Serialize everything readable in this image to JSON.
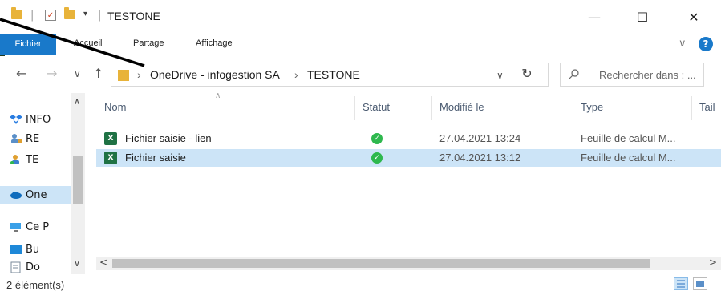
{
  "window": {
    "title": "TESTONE",
    "minimize": "—",
    "maximize": "☐",
    "close": "✕"
  },
  "ribbon": {
    "tabs": [
      "Fichier",
      "Accueil",
      "Partage",
      "Affichage"
    ],
    "collapse": "∨",
    "help": "?"
  },
  "address": {
    "back": "←",
    "forward": "→",
    "recent": "∨",
    "up": "↑",
    "sep": "›",
    "crumbs": [
      "OneDrive - infogestion SA",
      "TESTONE"
    ],
    "dropdown": "∨",
    "refresh": "↻",
    "search_placeholder": "Rechercher dans : ..."
  },
  "sidebar": {
    "items": [
      {
        "label": "INFO",
        "icon": "dropbox-icon"
      },
      {
        "label": "RE",
        "icon": "network-user-icon"
      },
      {
        "label": "TE",
        "icon": "user-icon"
      },
      {
        "label": "One",
        "icon": "onedrive-cloud-icon"
      },
      {
        "label": "Ce P",
        "icon": "pc-icon"
      },
      {
        "label": "Bu",
        "icon": "desktop-icon"
      },
      {
        "label": "Do",
        "icon": "documents-icon"
      }
    ]
  },
  "columns": {
    "name": "Nom",
    "status": "Statut",
    "modified": "Modifié le",
    "type": "Type",
    "size": "Tail"
  },
  "files": [
    {
      "name": "Fichier saisie - lien",
      "status": "synced",
      "modified": "27.04.2021 13:24",
      "type": "Feuille de calcul M..."
    },
    {
      "name": "Fichier saisie",
      "status": "synced",
      "modified": "27.04.2021 13:12",
      "type": "Feuille de calcul M..."
    }
  ],
  "status_bar": {
    "count": "2 élément(s)"
  },
  "colors": {
    "accent": "#1979ca",
    "selection": "#cce4f7",
    "synced": "#2eb84e",
    "excel": "#1f7244",
    "folder": "#e8b33a"
  }
}
